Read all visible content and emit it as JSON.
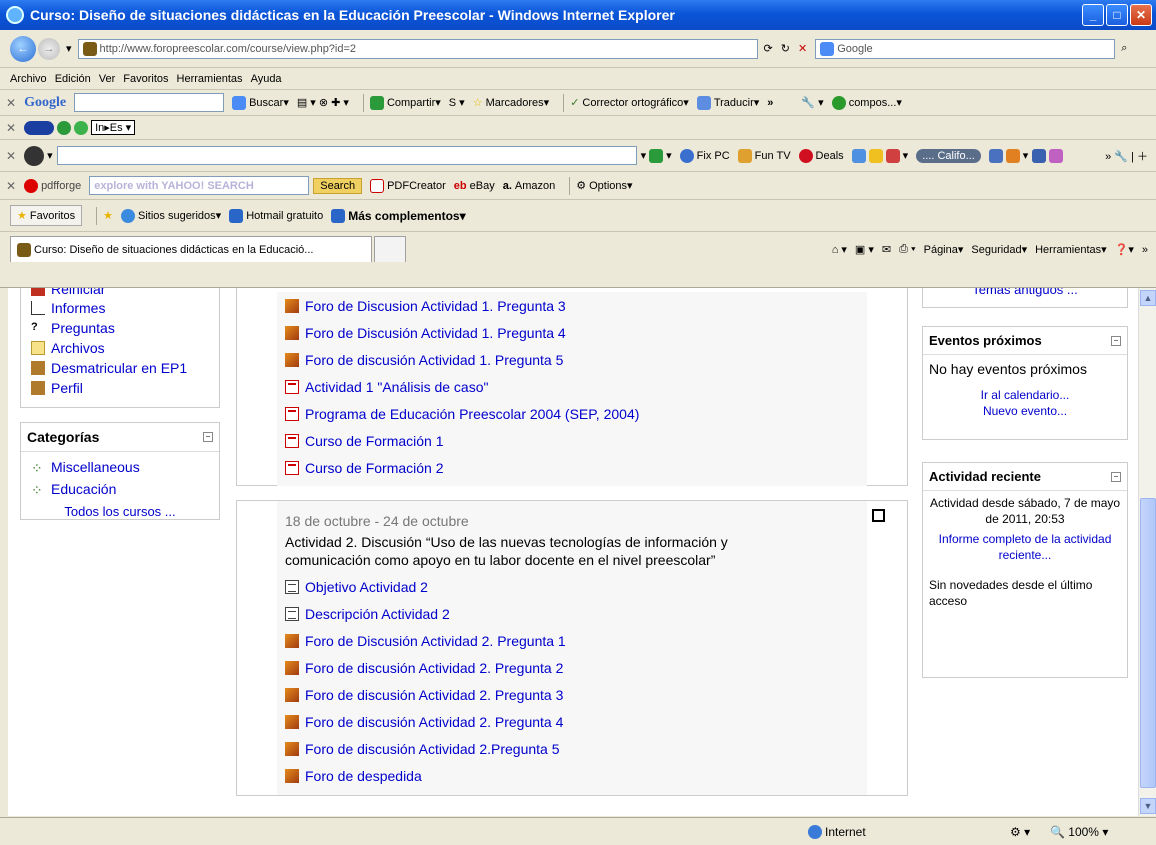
{
  "window": {
    "title": "Curso: Diseño de situaciones didácticas en la Educación Preescolar - Windows Internet Explorer"
  },
  "address": {
    "url": "http://www.foropreescolar.com/course/view.php?id=2",
    "search_placeholder": "Google"
  },
  "menubar": [
    "Archivo",
    "Edición",
    "Ver",
    "Favoritos",
    "Herramientas",
    "Ayuda"
  ],
  "google_bar": {
    "logo": "Google",
    "buscar": "Buscar",
    "compartir": "Compartir",
    "marcadores": "Marcadores",
    "corrector": "Corrector ortográfico",
    "traducir": "Traducir",
    "more": "»",
    "compos": "compos..."
  },
  "bar3": {
    "fixpc": "Fix PC",
    "funtv": "Fun TV",
    "deals": "Deals",
    "radio": ".... Califo..."
  },
  "pdfbar": {
    "logo": "pdfforge",
    "yahoo": "explore with YAHOO! SEARCH",
    "search": "Search",
    "pdfcreator": "PDFCreator",
    "ebay": "eBay",
    "amazon": "Amazon",
    "options": "Options"
  },
  "favbar": {
    "favoritos": "Favoritos",
    "sitios": "Sitios sugeridos",
    "hotmail": "Hotmail gratuito",
    "mas": "Más complementos"
  },
  "tab": {
    "label": "Curso: Diseño de situaciones didácticas en la Educació...",
    "pagina": "Página",
    "seguridad": "Seguridad",
    "herramientas": "Herramientas"
  },
  "left": {
    "admin_items": [
      "Reiniciar",
      "Informes",
      "Preguntas",
      "Archivos",
      "Desmatricular en EP1",
      "Perfil"
    ],
    "categorias_title": "Categorías",
    "categorias": [
      "Miscellaneous",
      "Educación"
    ],
    "todos": "Todos los cursos ..."
  },
  "week1": {
    "items": [
      {
        "icon": "forum",
        "text": "Foro de Discusion Actividad 1. Pregunta 3"
      },
      {
        "icon": "forum",
        "text": "Foro de Discusión Actividad 1. Pregunta 4"
      },
      {
        "icon": "forum",
        "text": "Foro de discusión Actividad 1. Pregunta 5"
      },
      {
        "icon": "pdf",
        "text": "Actividad 1 \"Análisis de caso\""
      },
      {
        "icon": "pdf",
        "text": "Programa de Educación Preescolar 2004 (SEP, 2004)"
      },
      {
        "icon": "pdf",
        "text": "Curso de Formación 1"
      },
      {
        "icon": "pdf",
        "text": "Curso de Formación 2"
      }
    ]
  },
  "week2": {
    "date": "18 de octubre - 24 de octubre",
    "summary": "Actividad 2. Discusión “Uso de las nuevas tecnologías de información y comunicación como apoyo en tu labor docente en el nivel preescolar”",
    "items": [
      {
        "icon": "doc",
        "text": "Objetivo Actividad 2"
      },
      {
        "icon": "doc",
        "text": "Descripción Actividad 2"
      },
      {
        "icon": "forum",
        "text": "Foro de Discusión Actividad 2. Pregunta 1"
      },
      {
        "icon": "forum",
        "text": "Foro de discusión Actividad 2. Pregunta 2"
      },
      {
        "icon": "forum",
        "text": "Foro de discusión Actividad 2. Pregunta 3"
      },
      {
        "icon": "forum",
        "text": "Foro de discusión Actividad 2. Pregunta 4"
      },
      {
        "icon": "forum",
        "text": "Foro de discusión Actividad 2.Pregunta 5"
      },
      {
        "icon": "forum",
        "text": "Foro de despedida"
      }
    ]
  },
  "right": {
    "temas": "Temas antiguos ...",
    "eventos_title": "Eventos próximos",
    "no_eventos": "No hay eventos próximos",
    "calendario": "Ir al calendario...",
    "nuevo_evento": "Nuevo evento...",
    "actividad_title": "Actividad reciente",
    "actividad_desde": "Actividad desde sábado, 7 de mayo de 2011, 20:53",
    "informe": "Informe completo de la actividad reciente...",
    "sin_novedades": "Sin novedades desde el último acceso"
  },
  "status": {
    "zone": "Internet",
    "zoom": "100%"
  }
}
